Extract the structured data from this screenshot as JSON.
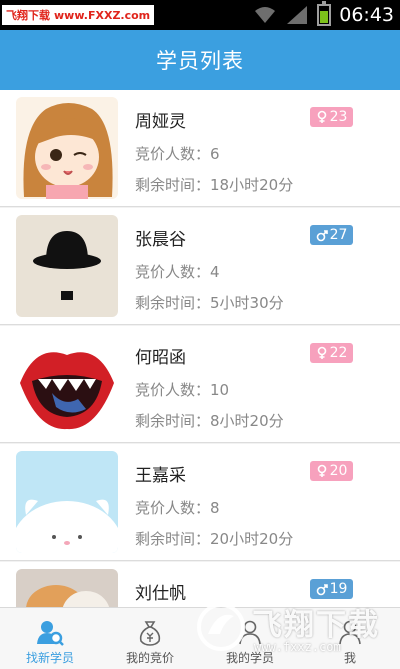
{
  "status_bar": {
    "watermark_site_a": "飞翔下载",
    "watermark_site_b": "www.FXXZ.com",
    "time": "06:43"
  },
  "header": {
    "title": "学员列表"
  },
  "students": [
    {
      "name": "周娅灵",
      "gender": "female",
      "age": "23",
      "bid_label": "竞价人数：",
      "bid_count": "6",
      "time_label": "剩余时间：",
      "time_left": "18小时20分"
    },
    {
      "name": "张晨谷",
      "gender": "male",
      "age": "27",
      "bid_label": "竞价人数：",
      "bid_count": "4",
      "time_label": "剩余时间：",
      "time_left": "5小时30分"
    },
    {
      "name": "何昭函",
      "gender": "female",
      "age": "22",
      "bid_label": "竞价人数：",
      "bid_count": "10",
      "time_label": "剩余时间：",
      "time_left": "8小时20分"
    },
    {
      "name": "王嘉采",
      "gender": "female",
      "age": "20",
      "bid_label": "竞价人数：",
      "bid_count": "8",
      "time_label": "剩余时间：",
      "time_left": "20小时20分"
    },
    {
      "name": "刘仕帆",
      "gender": "male",
      "age": "19",
      "bid_label": "",
      "bid_count": "",
      "time_label": "",
      "time_left": ""
    }
  ],
  "tabs": [
    {
      "label": "找新学员",
      "icon": "people-icon",
      "active": true
    },
    {
      "label": "我的竞价",
      "icon": "money-bag-icon",
      "active": false
    },
    {
      "label": "我的学员",
      "icon": "students-icon",
      "active": false
    },
    {
      "label": "我",
      "icon": "me-icon",
      "active": false
    }
  ],
  "watermark": {
    "text": "飞翔下载",
    "url": "www.fxxz.com"
  },
  "colors": {
    "header": "#3b9fe0",
    "female_badge": "#f7a1bd",
    "male_badge": "#5aa0d6",
    "active_tab": "#3b9fe0"
  }
}
